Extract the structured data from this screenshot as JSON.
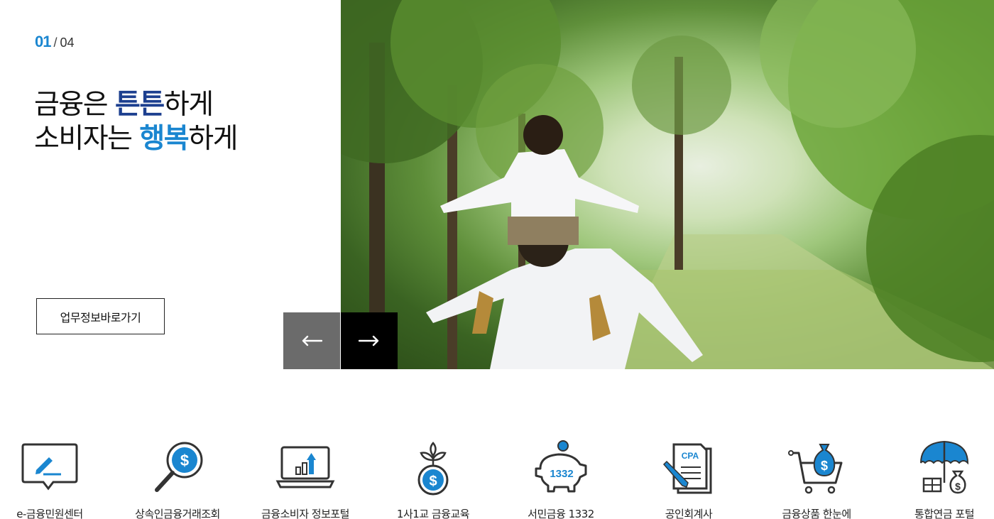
{
  "slider": {
    "current": "01",
    "separator": "/",
    "total": "04",
    "headline_line1_a": "금융은 ",
    "headline_line1_em": "튼튼",
    "headline_line1_b": "하게",
    "headline_line2_a": "소비자는 ",
    "headline_line2_em": "행복",
    "headline_line2_b": "하게",
    "cta_label": "업무정보바로가기",
    "prev_icon": "arrow-left-icon",
    "next_icon": "arrow-right-icon"
  },
  "colors": {
    "accent_blue": "#1a86d0",
    "accent_navy": "#1c3f8f",
    "prev_bg": "#6b6b6b",
    "next_bg": "#000000"
  },
  "quick_links": [
    {
      "label": "e-금융민원센터",
      "icon": "speech-pen-icon"
    },
    {
      "label": "상속인금융거래조회",
      "icon": "magnifier-dollar-icon"
    },
    {
      "label": "금융소비자 정보포털",
      "icon": "laptop-chart-icon"
    },
    {
      "label": "1사1교 금융교육",
      "icon": "sprout-coin-icon"
    },
    {
      "label": "서민금융 1332",
      "icon": "piggy-bank-icon",
      "badge": "1332"
    },
    {
      "label": "공인회계사",
      "icon": "cpa-document-icon",
      "badge": "CPA"
    },
    {
      "label": "금융상품 한눈에",
      "icon": "shopping-cart-money-icon"
    },
    {
      "label": "통합연금 포털",
      "icon": "umbrella-money-icon"
    }
  ]
}
